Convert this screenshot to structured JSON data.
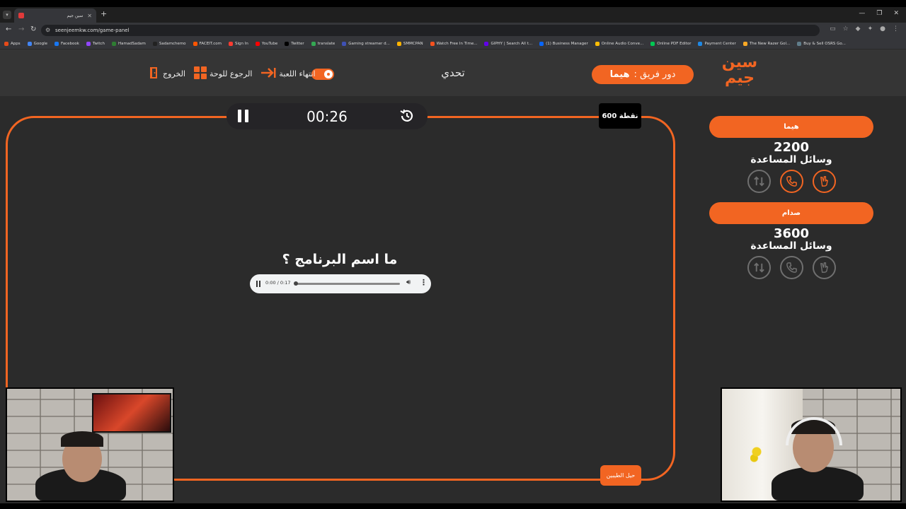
{
  "browser": {
    "tab_title": "سين جيم",
    "url": "seenjeemkw.com/game-panel",
    "bookmarks": [
      "Apps",
      "Google",
      "Facebook",
      "Twitch",
      "HamadSadam",
      "Sadamchemo",
      "FACEIT.com",
      "Sign In",
      "YouTube",
      "Twitter",
      "translate",
      "Gaming streamer d...",
      "SMMCPAN",
      "Watch Free In Time...",
      "GIPHY | Search All t...",
      "(1) Business Manager",
      "Online Audio Conve...",
      "Online PDF Editor",
      "Payment Center",
      "The New Razer Gol...",
      "Buy & Sell OSRS Go..."
    ],
    "bookmark_colors": [
      "#e64a19",
      "#4285f4",
      "#1877f2",
      "#9146ff",
      "#2e7d32",
      "#222222",
      "#ff5500",
      "#ff3b30",
      "#ff0000",
      "#000000",
      "#34a853",
      "#3f51b5",
      "#ffb300",
      "#f4511e",
      "#6200ea",
      "#0866ff",
      "#fbbc05",
      "#00c853",
      "#1e88e5",
      "#f9a825",
      "#607d8b"
    ]
  },
  "header": {
    "logo_text": "سين جيم",
    "turn_prefix": "دور فريق :",
    "turn_team": "هيما",
    "mode": "تحدي",
    "end_game": "انتهاء اللعبة",
    "back_to_board": "الرجوع للوحة",
    "exit": "الخروج"
  },
  "game": {
    "timer": "00:26",
    "points": "600 نقطة",
    "question": "ما اسم البرنامج ؟",
    "audio_time": "0:00 / 0:17",
    "help_button": "حيل الطيبين"
  },
  "teams": [
    {
      "name": "هيما",
      "score": "2200",
      "helpers_label": "وسائل المساعدة",
      "lifelines_active": [
        false,
        true,
        true
      ]
    },
    {
      "name": "صدام",
      "score": "3600",
      "helpers_label": "وسائل المساعدة",
      "lifelines_active": [
        false,
        false,
        false
      ]
    }
  ],
  "colors": {
    "accent": "#f26522",
    "background": "#2b2b2b",
    "header": "#353535"
  }
}
